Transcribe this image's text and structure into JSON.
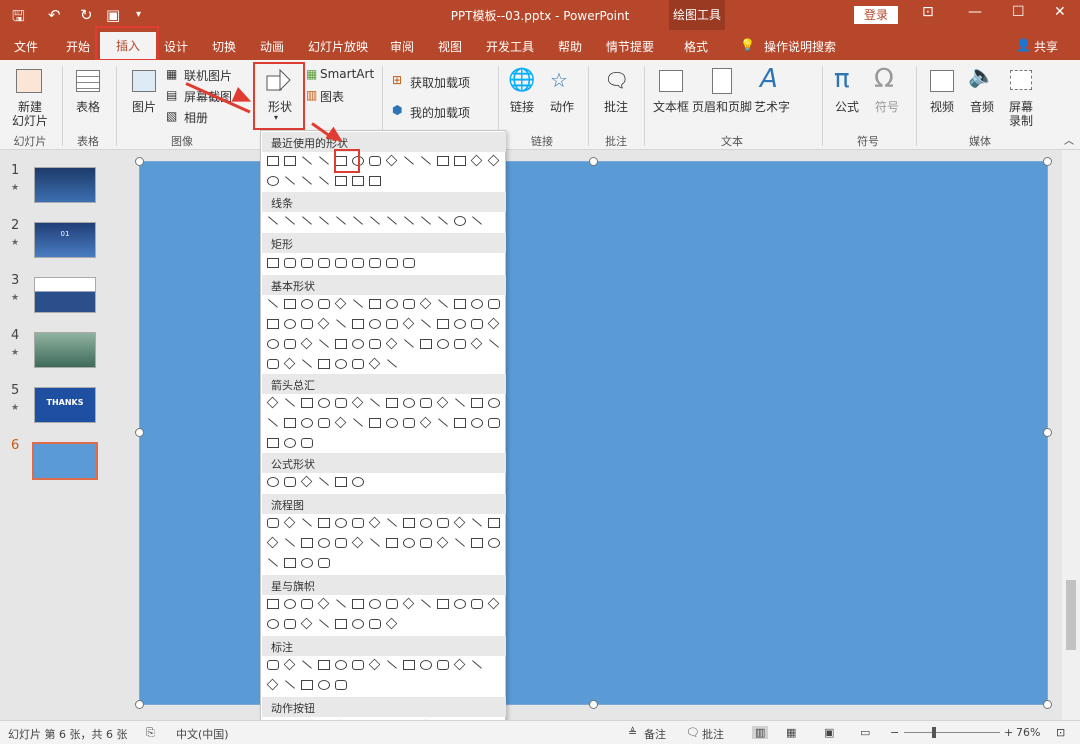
{
  "titlebar": {
    "title": "PPT模板--03.pptx  -  PowerPoint",
    "context_title": "绘图工具",
    "login": "登录"
  },
  "menu": {
    "tabs": [
      "文件",
      "开始",
      "插入",
      "设计",
      "切换",
      "动画",
      "幻灯片放映",
      "审阅",
      "视图",
      "开发工具",
      "帮助",
      "情节提要",
      "格式"
    ],
    "search": "操作说明搜索",
    "share": "共享"
  },
  "ribbon": {
    "new_slide": "新建",
    "new_slide2": "幻灯片",
    "table": "表格",
    "image": "图片",
    "online_image": "联机图片",
    "screenshot": "屏幕截图",
    "album": "相册",
    "shapes": "形状",
    "smartart": "SmartArt",
    "chart": "图表",
    "get_addins": "获取加载项",
    "my_addins": "我的加载项",
    "link": "链接",
    "action": "动作",
    "comment": "批注",
    "textbox": "文本框",
    "header_footer": "页眉和页脚",
    "wordart": "艺术字",
    "equation": "公式",
    "symbol": "符号",
    "video": "视频",
    "audio": "音频",
    "screen_record": "屏幕",
    "screen_record2": "录制",
    "groups": {
      "slides": "幻灯片",
      "tables": "表格",
      "images": "图像",
      "links": "链接",
      "comments": "批注",
      "text": "文本",
      "symbols": "符号",
      "media": "媒体"
    }
  },
  "shapes_menu": {
    "sections": [
      "最近使用的形状",
      "线条",
      "矩形",
      "基本形状",
      "箭头总汇",
      "公式形状",
      "流程图",
      "星与旗帜",
      "标注",
      "动作按钮"
    ]
  },
  "thumbnails": [
    {
      "num": "1",
      "star": "★",
      "label": ""
    },
    {
      "num": "2",
      "star": "★",
      "label": "01"
    },
    {
      "num": "3",
      "star": "★",
      "label": ""
    },
    {
      "num": "4",
      "star": "★",
      "label": ""
    },
    {
      "num": "5",
      "star": "★",
      "label": "THANKS"
    },
    {
      "num": "6",
      "star": "",
      "label": ""
    }
  ],
  "status": {
    "slide_info": "幻灯片 第 6 张，共 6 张",
    "language": "中文(中国)",
    "notes": "备注",
    "comments": "批注",
    "zoom": "76%"
  },
  "colors": {
    "accent": "#b7472a",
    "slide_fill": "#5b9bd5",
    "highlight": "#e03c31"
  }
}
